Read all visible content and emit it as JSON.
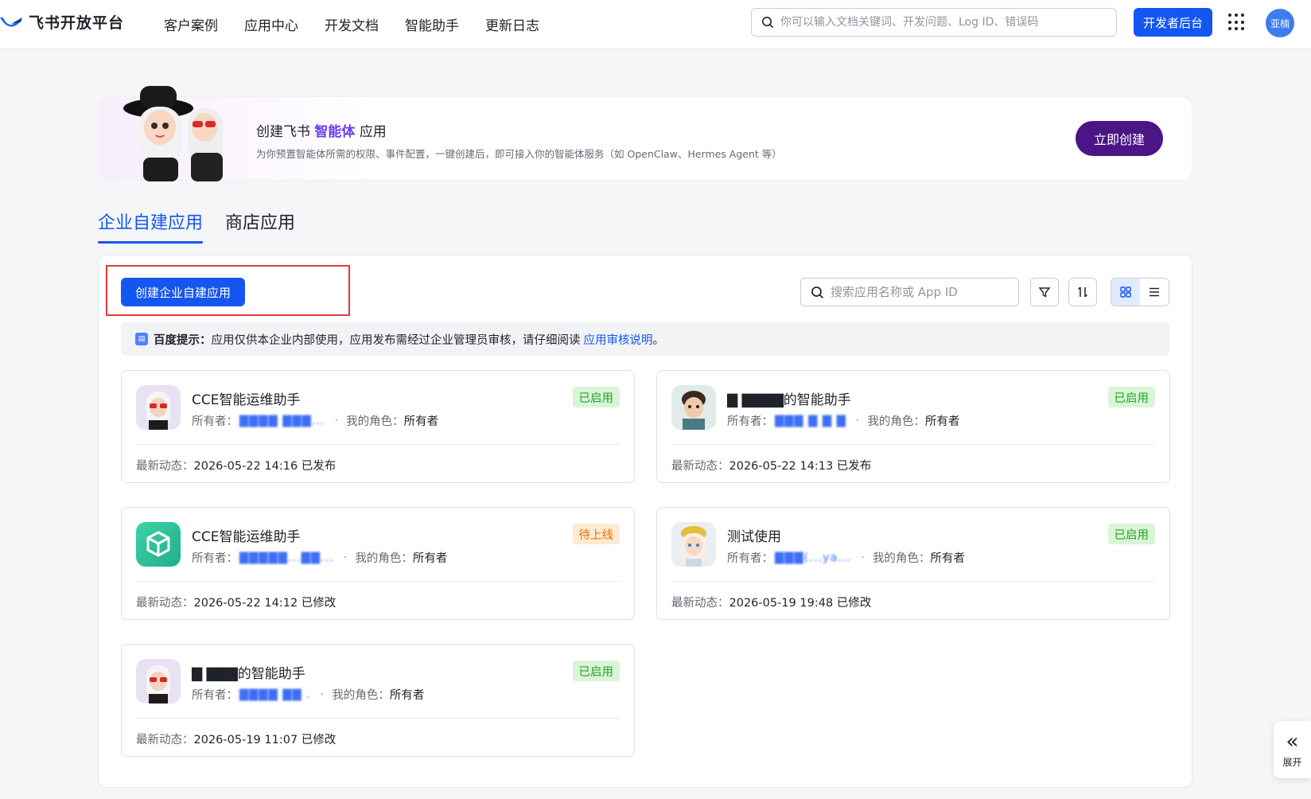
{
  "topbar": {
    "brand": "飞书开放平台",
    "nav": [
      "客户案例",
      "应用中心",
      "开发文档",
      "智能助手",
      "更新日志"
    ],
    "search_placeholder": "你可以输入文档关键词、开发问题、Log ID、错误码",
    "dev_button": "开发者后台",
    "avatar_text": "亚楠"
  },
  "banner": {
    "title_prefix": "创建飞书",
    "title_highlight": "智能体",
    "title_suffix": "应用",
    "subtitle": "为你预置智能体所需的权限、事件配置，一键创建后，即可接入你的智能体服务（如 OpenClaw、Hermes Agent 等）",
    "button": "立即创建"
  },
  "tabs": [
    "企业自建应用",
    "商店应用"
  ],
  "toolbar": {
    "create_button": "创建企业自建应用",
    "search_placeholder": "搜索应用名称或 App ID"
  },
  "notice": {
    "label": "百度提示：",
    "text": "应用仅供本企业内部使用，应用发布需经过企业管理员审核，请仔细阅读",
    "link": "应用审核说明",
    "end": "。"
  },
  "labels": {
    "owner": "所有者：",
    "role": "我的角色：",
    "latest": "最新动态："
  },
  "cards": [
    {
      "name": "CCE智能运维助手",
      "owner": "▇▇▇▇ ▇▇▇...",
      "role": "所有者",
      "status": "已启用",
      "latest": "2026-05-22 14:16 已发布"
    },
    {
      "name": "▇ ▇▇▇▇的智能助手",
      "owner": "▇▇▇ ▇ ▇ ▇",
      "role": "所有者",
      "status": "已启用",
      "latest": "2026-05-22 14:13 已发布"
    },
    {
      "name": "CCE智能运维助手",
      "owner": "▇▇▇▇▇...▇▇...",
      "role": "所有者",
      "status": "待上线",
      "latest": "2026-05-22 14:12 已修改"
    },
    {
      "name": "测试使用",
      "owner": "▇▇▇(...ya...",
      "role": "所有者",
      "status": "已启用",
      "latest": "2026-05-19 19:48 已修改"
    },
    {
      "name": "▇ ▇▇▇的智能助手",
      "owner": "▇▇▇▇ ▇▇ .",
      "role": "所有者",
      "status": "已启用",
      "latest": "2026-05-19 11:07 已修改"
    }
  ],
  "expand_label": "展开",
  "colors": {
    "primary": "#1456f0",
    "banner_button": "#4a1686",
    "highlight_box": "#e5383b",
    "status_on": "#24a12a",
    "status_wait": "#ed6d0c"
  }
}
